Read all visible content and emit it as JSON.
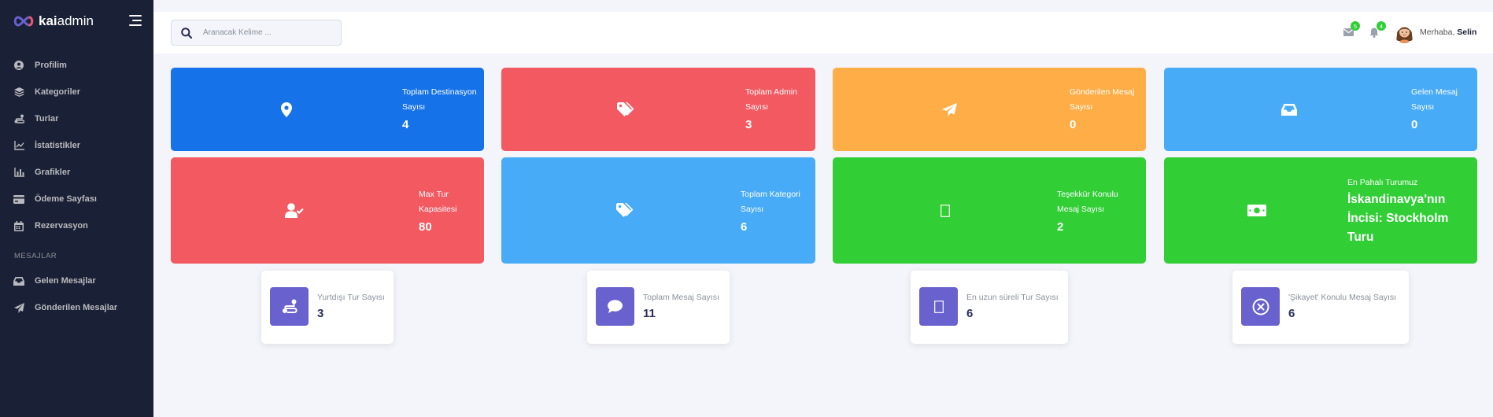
{
  "brand": {
    "name_bold": "kai",
    "name_rest": "admin",
    "logo_color": "#6861ce"
  },
  "sidebar": {
    "items": [
      {
        "label": "Profilim",
        "icon": "user-circle-icon"
      },
      {
        "label": "Kategoriler",
        "icon": "layers-icon"
      },
      {
        "label": "Turlar",
        "icon": "route-icon"
      },
      {
        "label": "İstatistikler",
        "icon": "line-chart-icon"
      },
      {
        "label": "Grafikler",
        "icon": "bar-chart-icon"
      },
      {
        "label": "Ödeme Sayfası",
        "icon": "credit-card-icon"
      },
      {
        "label": "Rezervasyon",
        "icon": "calendar-icon"
      }
    ],
    "section_label": "MESAJLAR",
    "message_items": [
      {
        "label": "Gelen Mesajlar",
        "icon": "inbox-icon"
      },
      {
        "label": "Gönderilen Mesajlar",
        "icon": "paper-plane-icon"
      }
    ]
  },
  "header": {
    "search_placeholder": "Aranacak Kelime ...",
    "messages_badge": "5",
    "notifications_badge": "4",
    "greeting": "Merhaba,",
    "user_name": "Selin"
  },
  "stats": [
    {
      "title": "Toplam Destinasyon Sayısı",
      "value": "4",
      "icon": "map-marker-icon",
      "color": "#1572e8"
    },
    {
      "title": "Toplam Admin Sayısı",
      "value": "3",
      "icon": "tags-icon",
      "color": "#f25961"
    },
    {
      "title": "Gönderilen Mesaj Sayısı",
      "value": "0",
      "icon": "paper-plane-icon",
      "color": "#ffad46"
    },
    {
      "title": "Gelen Mesaj Sayısı",
      "value": "0",
      "icon": "inbox-icon",
      "color": "#48abf7"
    },
    {
      "title": "Max Tur Kapasitesi",
      "value": "80",
      "icon": "user-check-icon",
      "color": "#f25961"
    },
    {
      "title": "Toplam Kategori Sayısı",
      "value": "6",
      "icon": "tags-icon",
      "color": "#48abf7"
    },
    {
      "title": "Teşekkür Konulu Mesaj Sayısı",
      "value": "2",
      "icon": "missing-glyph-icon",
      "color": "#31ce36"
    },
    {
      "title": "En Pahalı Turumuz",
      "value": "İskandinavya'nın İncisi: Stockholm Turu",
      "icon": "money-bill-icon",
      "color": "#31ce36"
    }
  ],
  "mini_stats": [
    {
      "label": "Yurtdışı Tur Sayısı",
      "value": "3",
      "icon": "route-icon"
    },
    {
      "label": "Toplam Mesaj Sayısı",
      "value": "11",
      "icon": "comment-icon"
    },
    {
      "label": "En uzun süreli Tur Sayısı",
      "value": "6",
      "icon": "missing-glyph-icon"
    },
    {
      "label": "'Şikayet' Konulu Mesaj Sayısı",
      "value": "6",
      "icon": "times-circle-icon"
    }
  ]
}
